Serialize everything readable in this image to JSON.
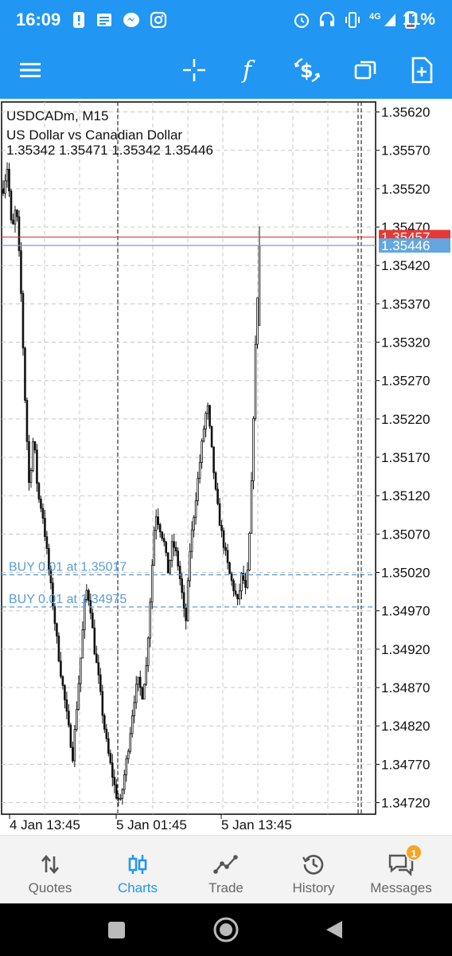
{
  "status_bar": {
    "time": "16:09",
    "network": "4G",
    "battery": "11%",
    "left_icons": [
      "alert-icon",
      "news-icon",
      "messenger-icon",
      "instagram-icon"
    ],
    "right_icons": [
      "alarm-icon",
      "headset-icon",
      "vibrate-icon",
      "signal-icon",
      "battery-icon"
    ]
  },
  "toolbar": {
    "icons": [
      "menu-icon",
      "crosshair-icon",
      "indicators-icon",
      "trade-dollar-icon",
      "windows-icon",
      "add-object-icon"
    ]
  },
  "chart_info": {
    "symbol_line": "USDCADm, M15",
    "description": "US Dollar vs Canadian Dollar",
    "ohlc": "1.35342 1.35471 1.35342 1.35446"
  },
  "chart_data": {
    "type": "candlestick",
    "symbol": "USDCADm",
    "timeframe": "M15",
    "ylim": [
      1.34705,
      1.35633
    ],
    "price_ticks": [
      "1.35620",
      "1.35570",
      "1.35520",
      "1.35470",
      "1.35420",
      "1.35370",
      "1.35320",
      "1.35270",
      "1.35220",
      "1.35170",
      "1.35120",
      "1.35070",
      "1.35020",
      "1.34970",
      "1.34920",
      "1.34870",
      "1.34820",
      "1.34770",
      "1.34720"
    ],
    "time_labels": [
      "4 Jan 13:45",
      "5 Jan 01:45",
      "5 Jan 13:45"
    ],
    "bid": "1.35446",
    "ask": "1.35457",
    "orders": [
      {
        "label": "BUY 0.01 at 1.35017",
        "price": 1.35017
      },
      {
        "label": "BUY 0.01 at 1.34975",
        "price": 1.34975
      }
    ],
    "close_path": [
      1.3552,
      1.3555,
      1.3546,
      1.355,
      1.354,
      1.3525,
      1.3513,
      1.352,
      1.3512,
      1.351,
      1.3505,
      1.35,
      1.3495,
      1.349,
      1.3486,
      1.3482,
      1.3478,
      1.3485,
      1.3492,
      1.35,
      1.3498,
      1.3492,
      1.3488,
      1.3483,
      1.3479,
      1.3476,
      1.3473,
      1.3472,
      1.3476,
      1.348,
      1.3485,
      1.3488,
      1.3486,
      1.349,
      1.35,
      1.351,
      1.3508,
      1.3506,
      1.3502,
      1.3506,
      1.3504,
      1.35,
      1.3495,
      1.3505,
      1.351,
      1.3515,
      1.352,
      1.3524,
      1.3518,
      1.3512,
      1.3508,
      1.3505,
      1.3502,
      1.35,
      1.3498,
      1.3502,
      1.3499,
      1.351,
      1.353,
      1.3545
    ]
  },
  "bottom_nav": {
    "items": [
      {
        "label": "Quotes",
        "icon": "quotes-icon"
      },
      {
        "label": "Charts",
        "icon": "charts-icon"
      },
      {
        "label": "Trade",
        "icon": "trade-icon"
      },
      {
        "label": "History",
        "icon": "history-icon"
      },
      {
        "label": "Messages",
        "icon": "messages-icon"
      }
    ],
    "active": "Charts",
    "messages_badge": "1"
  },
  "colors": {
    "primary": "#2196f3",
    "ask_line": "#e53935",
    "bid_line": "#64a6e0",
    "order_line": "#5b9bd5",
    "badge": "#f5a623"
  }
}
